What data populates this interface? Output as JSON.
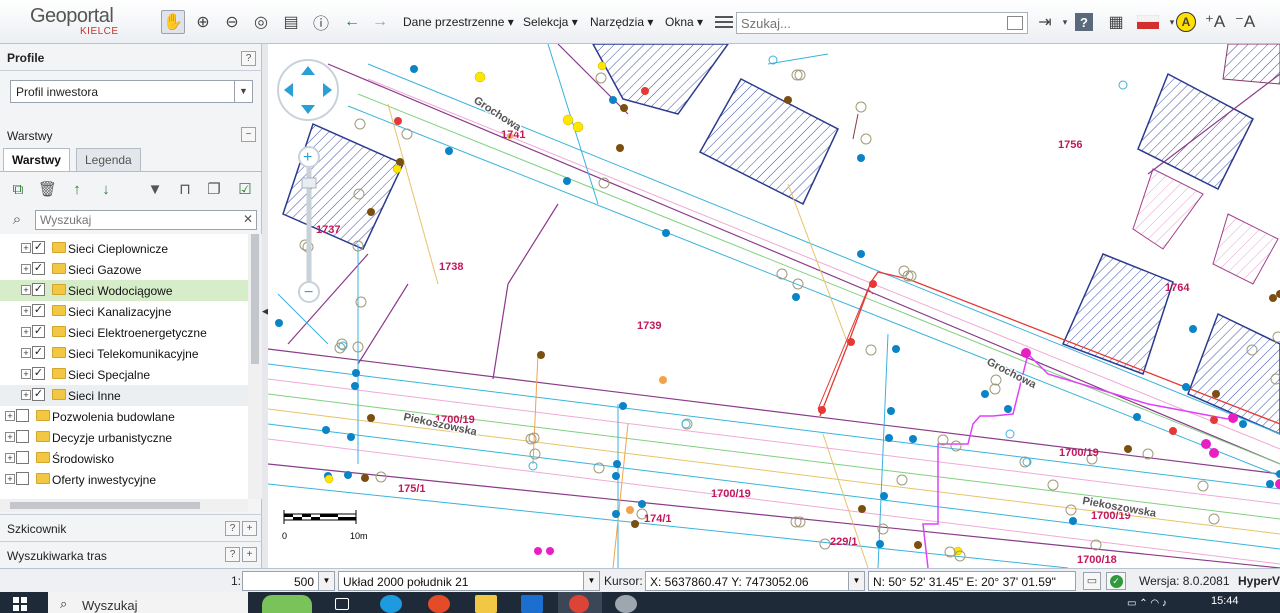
{
  "header": {
    "logo_main": "Geoportal",
    "logo_sub": "KIELCE",
    "menus": [
      {
        "label": "Dane przestrzenne"
      },
      {
        "label": "Selekcja"
      },
      {
        "label": "Narzędzia"
      },
      {
        "label": "Okna"
      }
    ],
    "search_placeholder": "Szukaj..."
  },
  "left_panel": {
    "profile": {
      "title": "Profile",
      "selected": "Profil inwestora"
    },
    "layers": {
      "title": "Warstwy",
      "tabs": [
        {
          "label": "Warstwy",
          "active": true
        },
        {
          "label": "Legenda",
          "active": false
        }
      ],
      "search_placeholder": "Wyszukaj",
      "items": [
        {
          "label": "Sieci Cieplownicze",
          "checked": true,
          "level": 1
        },
        {
          "label": "Sieci Gazowe",
          "checked": true,
          "level": 1
        },
        {
          "label": "Sieci Wodociągowe",
          "checked": true,
          "level": 1,
          "selected": true
        },
        {
          "label": "Sieci Kanalizacyjne",
          "checked": true,
          "level": 1
        },
        {
          "label": "Sieci Elektroenergetyczne",
          "checked": true,
          "level": 1
        },
        {
          "label": "Sieci Telekomunikacyjne",
          "checked": true,
          "level": 1
        },
        {
          "label": "Sieci Specjalne",
          "checked": true,
          "level": 1
        },
        {
          "label": "Sieci Inne",
          "checked": true,
          "level": 1
        },
        {
          "label": "Pozwolenia budowlane",
          "checked": false,
          "level": 0
        },
        {
          "label": "Decyzje urbanistyczne",
          "checked": false,
          "level": 0
        },
        {
          "label": "Środowisko",
          "checked": false,
          "level": 0
        },
        {
          "label": "Oferty inwestycyjne",
          "checked": false,
          "level": 0
        }
      ]
    },
    "bottom_sections": [
      {
        "title": "Szkicownik"
      },
      {
        "title": "Wyszukiwarka tras"
      }
    ]
  },
  "map": {
    "parcel_labels": [
      "1741",
      "1756",
      "1737",
      "1738",
      "1739",
      "1764",
      "1700/19",
      "1700/19",
      "1700/19",
      "1700/19",
      "175/1",
      "174/1",
      "229/1",
      "1700/18"
    ],
    "street_labels": [
      "Grochowa",
      "Grochowa",
      "Piekoszowska",
      "Piekoszowska"
    ],
    "scale_labels": [
      "0",
      "10m"
    ]
  },
  "status_bar": {
    "scale_prefix": "1:",
    "scale_value": "500",
    "crs": "Układ 2000 południk 21",
    "cursor_label": "Kursor:",
    "cursor_xy": "X: 5637860.47  Y: 7473052.06",
    "cursor_geo": "N: 50° 52' 31.45\" E: 20° 37' 01.59\"",
    "version": "Wersja: 8.0.2081",
    "brand": "HyperV"
  },
  "taskbar": {
    "search_placeholder": "Wyszukaj",
    "time": "15:44"
  },
  "colors": {
    "accent": "#2a66b1",
    "selected_row": "#d7edc9",
    "parcel_label": "#c2185b",
    "water_point": "#0a84c6",
    "gas_point": "#7a4f10"
  }
}
